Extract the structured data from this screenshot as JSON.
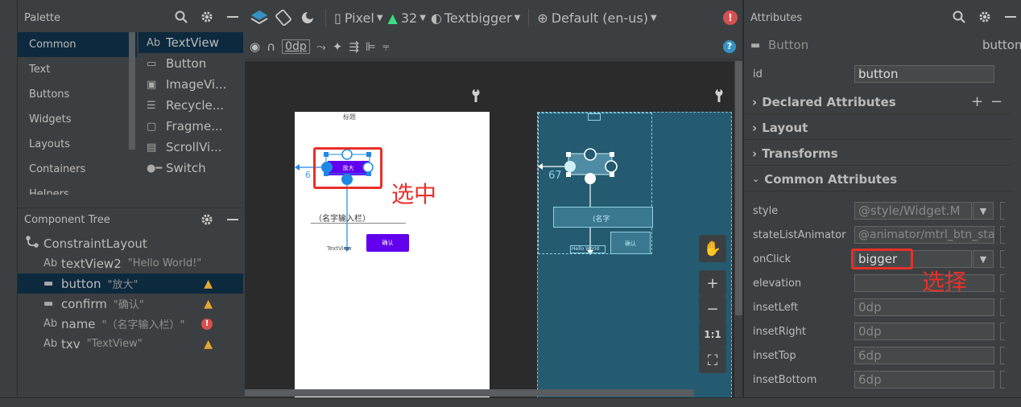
{
  "palette": {
    "title": "Palette",
    "categories": [
      "Common",
      "Text",
      "Buttons",
      "Widgets",
      "Layouts",
      "Containers",
      "Helpers"
    ],
    "items": [
      {
        "icon": "Ab",
        "label": "TextView"
      },
      {
        "icon": "▭",
        "label": "Button"
      },
      {
        "icon": "▣",
        "label": "ImageVi..."
      },
      {
        "icon": "☰",
        "label": "Recycle..."
      },
      {
        "icon": "▢",
        "label": "Fragme..."
      },
      {
        "icon": "▤",
        "label": "ScrollVi..."
      },
      {
        "icon": "●━",
        "label": "Switch"
      }
    ]
  },
  "component_tree": {
    "title": "Component Tree",
    "root": "ConstraintLayout",
    "nodes": [
      {
        "icon": "Ab",
        "name": "textView2",
        "sub": "\"Hello World!\"",
        "status": ""
      },
      {
        "icon": "▬",
        "name": "button",
        "sub": "\"放大\"",
        "status": "warn"
      },
      {
        "icon": "▬",
        "name": "confirm",
        "sub": "\"确认\"",
        "status": "warn"
      },
      {
        "icon": "Ab",
        "name": "name",
        "sub": "\"（名字输入栏）\"",
        "status": "error"
      },
      {
        "icon": "Ab",
        "name": "txv",
        "sub": "\"TextView\"",
        "status": "warn"
      }
    ],
    "error_glyph": "!"
  },
  "toolbar": {
    "device": "Pixel",
    "api": "32",
    "theme": "Textbigger",
    "locale": "Default (en-us)",
    "margin": "0dp",
    "error_glyph": "!",
    "help_glyph": "?"
  },
  "canvas": {
    "design_title": "标题",
    "design_button": "放大",
    "design_edit": "（名字输入栏）",
    "design_confirm": "确认",
    "design_textview": "TextView",
    "design_margin": "6",
    "bp_margin": "67",
    "bp_field_text": "(名字",
    "bp_hello": "Hello World",
    "bp_confirm": "确认",
    "zoom": {
      "pan": "✋",
      "in": "+",
      "out": "−",
      "fit": "1:1",
      "screen": "⛶"
    }
  },
  "annotations": {
    "select_note": "选中",
    "choose_note": "选择"
  },
  "attributes": {
    "title": "Attributes",
    "widget_type": "Button",
    "widget_id_short": "button",
    "id_label": "id",
    "id_value": "button",
    "sections": [
      "Declared Attributes",
      "Layout",
      "Transforms",
      "Common Attributes"
    ],
    "rows": [
      {
        "label": "style",
        "value": "@style/Widget.M",
        "placeholder": true,
        "combo": true
      },
      {
        "label": "stateListAnimator",
        "value": "@animator/mtrl_btn_sta",
        "placeholder": true,
        "combo": false
      },
      {
        "label": "onClick",
        "value": "bigger",
        "placeholder": false,
        "combo": true
      },
      {
        "label": "elevation",
        "value": "",
        "placeholder": false,
        "combo": false
      },
      {
        "label": "insetLeft",
        "value": "0dp",
        "placeholder": true,
        "combo": false
      },
      {
        "label": "insetRight",
        "value": "0dp",
        "placeholder": true,
        "combo": false
      },
      {
        "label": "insetTop",
        "value": "6dp",
        "placeholder": true,
        "combo": false
      },
      {
        "label": "insetBottom",
        "value": "6dp",
        "placeholder": true,
        "combo": false
      }
    ]
  },
  "colors": {
    "accent_purple": "#6200ee",
    "selection_blue": "#1e88e5",
    "annotation_red": "#e8302a",
    "warning": "#e5a733",
    "error": "#d75050"
  }
}
